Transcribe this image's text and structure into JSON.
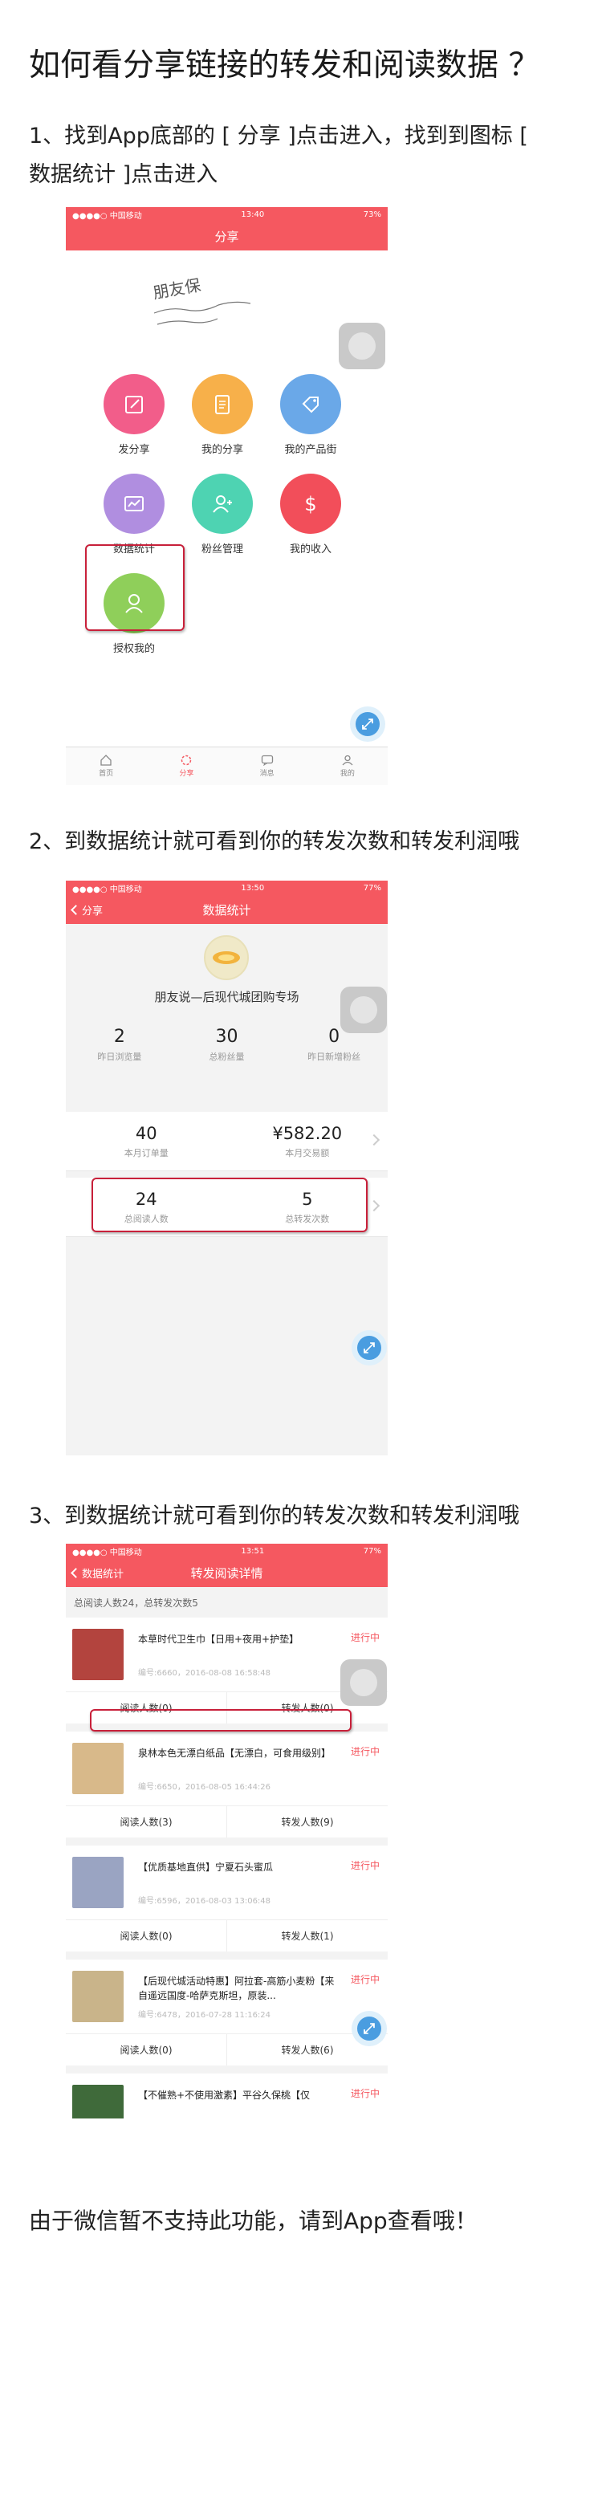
{
  "page": {
    "title": "如何看分享链接的转发和阅读数据 ？",
    "step1": "1、找到App底部的 [ 分享 ]点击进入，找到到图标 [ 数据统计 ]点击进入",
    "step2": "2、到数据统计就可看到你的转发次数和转发利润哦",
    "step3": "3、到数据统计就可看到你的转发次数和转发利润哦",
    "footer": "由于微信暂不支持此功能，请到App查看哦！"
  },
  "phone1": {
    "status": {
      "carrier": "●●●●○ 中国移动",
      "time": "13:40",
      "battery": "73%"
    },
    "nav_title": "分享",
    "signature": "朋友保",
    "grid": [
      {
        "label": "发分享",
        "color": "#f25d8a",
        "icon": "edit-icon"
      },
      {
        "label": "我的分享",
        "color": "#f7b04a",
        "icon": "document-icon"
      },
      {
        "label": "我的产品街",
        "color": "#6aa8e8",
        "icon": "tag-icon"
      },
      {
        "label": "数据统计",
        "color": "#b08ee0",
        "icon": "chart-icon"
      },
      {
        "label": "粉丝管理",
        "color": "#4ed3b2",
        "icon": "fans-icon"
      },
      {
        "label": "我的收入",
        "color": "#f24e5a",
        "icon": "dollar-icon"
      },
      {
        "label": "授权我的",
        "color": "#8fcf5a",
        "icon": "person-icon"
      }
    ],
    "tabs": [
      "首页",
      "分享",
      "消息",
      "我的"
    ]
  },
  "phone2": {
    "status": {
      "carrier": "●●●●○ 中国移动",
      "time": "13:50",
      "battery": "77%"
    },
    "nav_back": "分享",
    "nav_title": "数据统计",
    "shop_name": "朋友说—后现代城团购专场",
    "stats": [
      {
        "value": "2",
        "label": "昨日浏览量"
      },
      {
        "value": "30",
        "label": "总粉丝量"
      },
      {
        "value": "0",
        "label": "昨日新增粉丝"
      }
    ],
    "orders": {
      "value": "40",
      "label": "本月订单量"
    },
    "sales": {
      "value": "¥582.20",
      "label": "本月交易额"
    },
    "readers": {
      "value": "24",
      "label": "总阅读人数"
    },
    "forwards": {
      "value": "5",
      "label": "总转发次数"
    }
  },
  "phone3": {
    "status": {
      "carrier": "●●●●○ 中国移动",
      "time": "13:51",
      "battery": "77%"
    },
    "nav_back": "数据统计",
    "nav_title": "转发阅读详情",
    "summary": "总阅读人数24，总转发次数5",
    "articles": [
      {
        "title": "本草时代卫生巾【日用+夜用+护垫】",
        "meta": "编号:6660，2016-08-08 16:58:48",
        "status": "进行中",
        "read": "阅读人数(0)",
        "forward": "转发人数(0)",
        "thumb": "#b3443e"
      },
      {
        "title": "泉林本色无漂白纸品【无漂白，可食用级别】",
        "meta": "编号:6650，2016-08-05 16:44:26",
        "status": "进行中",
        "read": "阅读人数(3)",
        "forward": "转发人数(9)",
        "thumb": "#d8b98a"
      },
      {
        "title": "【优质基地直供】宁夏石头蜜瓜",
        "meta": "编号:6596，2016-08-03 13:06:48",
        "status": "进行中",
        "read": "阅读人数(0)",
        "forward": "转发人数(1)",
        "thumb": "#9aa4c2"
      },
      {
        "title": "【后现代城活动特惠】阿拉套-高筋小麦粉【来自遥远国度-哈萨克斯坦，原装...",
        "meta": "编号:6478，2016-07-28 11:16:24",
        "status": "进行中",
        "read": "阅读人数(0)",
        "forward": "转发人数(6)",
        "thumb": "#c9b48a"
      },
      {
        "title": "【不催熟+不使用激素】平谷久保桃【仅",
        "meta": "",
        "status": "进行中",
        "read": "",
        "forward": "",
        "thumb": "#3f6a3a"
      }
    ]
  }
}
